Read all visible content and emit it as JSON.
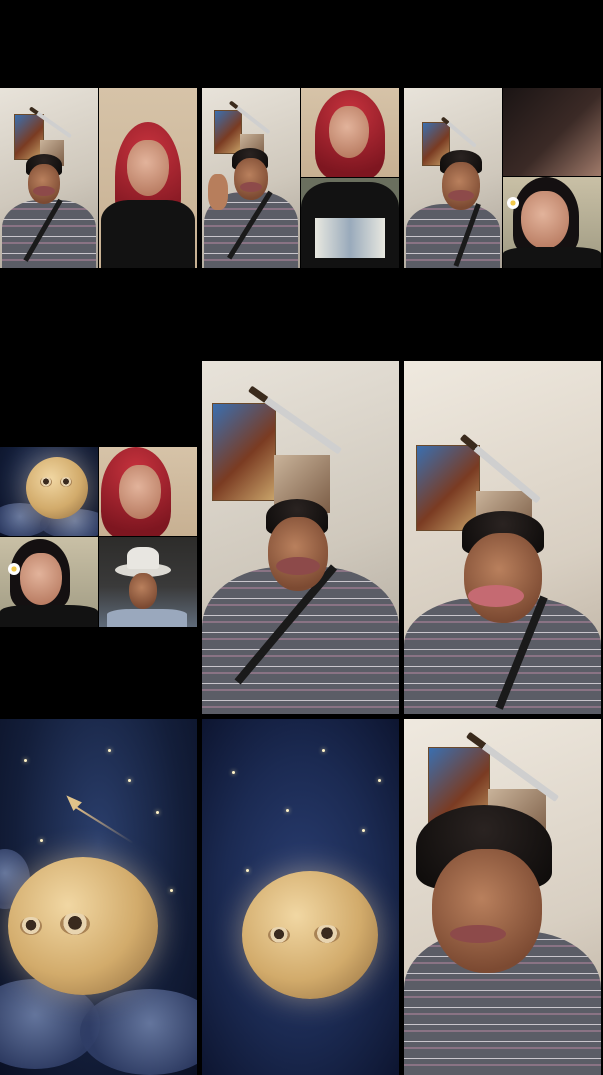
{
  "page": {
    "background": "#000000",
    "panels": [
      {
        "id": "panel-1",
        "kind": "split-call",
        "subjects": [
          "masked-man",
          "red-hair-woman"
        ]
      },
      {
        "id": "panel-2",
        "kind": "split-call",
        "subjects": [
          "masked-man",
          "red-hair-woman",
          "graphic-shirt"
        ]
      },
      {
        "id": "panel-3",
        "kind": "split-call",
        "subjects": [
          "masked-man",
          "hair-closeup",
          "dark-hair-woman"
        ]
      },
      {
        "id": "panel-4",
        "kind": "grid-call",
        "subjects": [
          "moon-face",
          "red-hair-woman",
          "dark-hair-woman",
          "cowboy-man"
        ]
      },
      {
        "id": "panel-5",
        "kind": "full-video",
        "subjects": [
          "masked-man"
        ]
      },
      {
        "id": "panel-6",
        "kind": "full-video",
        "subjects": [
          "tongue-filter-man"
        ]
      },
      {
        "id": "panel-7",
        "kind": "full-video",
        "subjects": [
          "moon-face",
          "rocket"
        ]
      },
      {
        "id": "panel-8",
        "kind": "full-video",
        "subjects": [
          "moon-face"
        ]
      },
      {
        "id": "panel-9",
        "kind": "full-video",
        "subjects": [
          "man"
        ]
      }
    ]
  },
  "colors": {
    "wall": "#e8e3da",
    "shirt_stripe": "#5b5d66",
    "red_hair": "#c6323d",
    "night_sky": "#131e3a",
    "moon": "#d2ab6b"
  },
  "icons": [
    "poster-icon",
    "machete-icon",
    "moon-face-icon",
    "rocket-icon",
    "flower-icon",
    "cowboy-hat-icon"
  ]
}
